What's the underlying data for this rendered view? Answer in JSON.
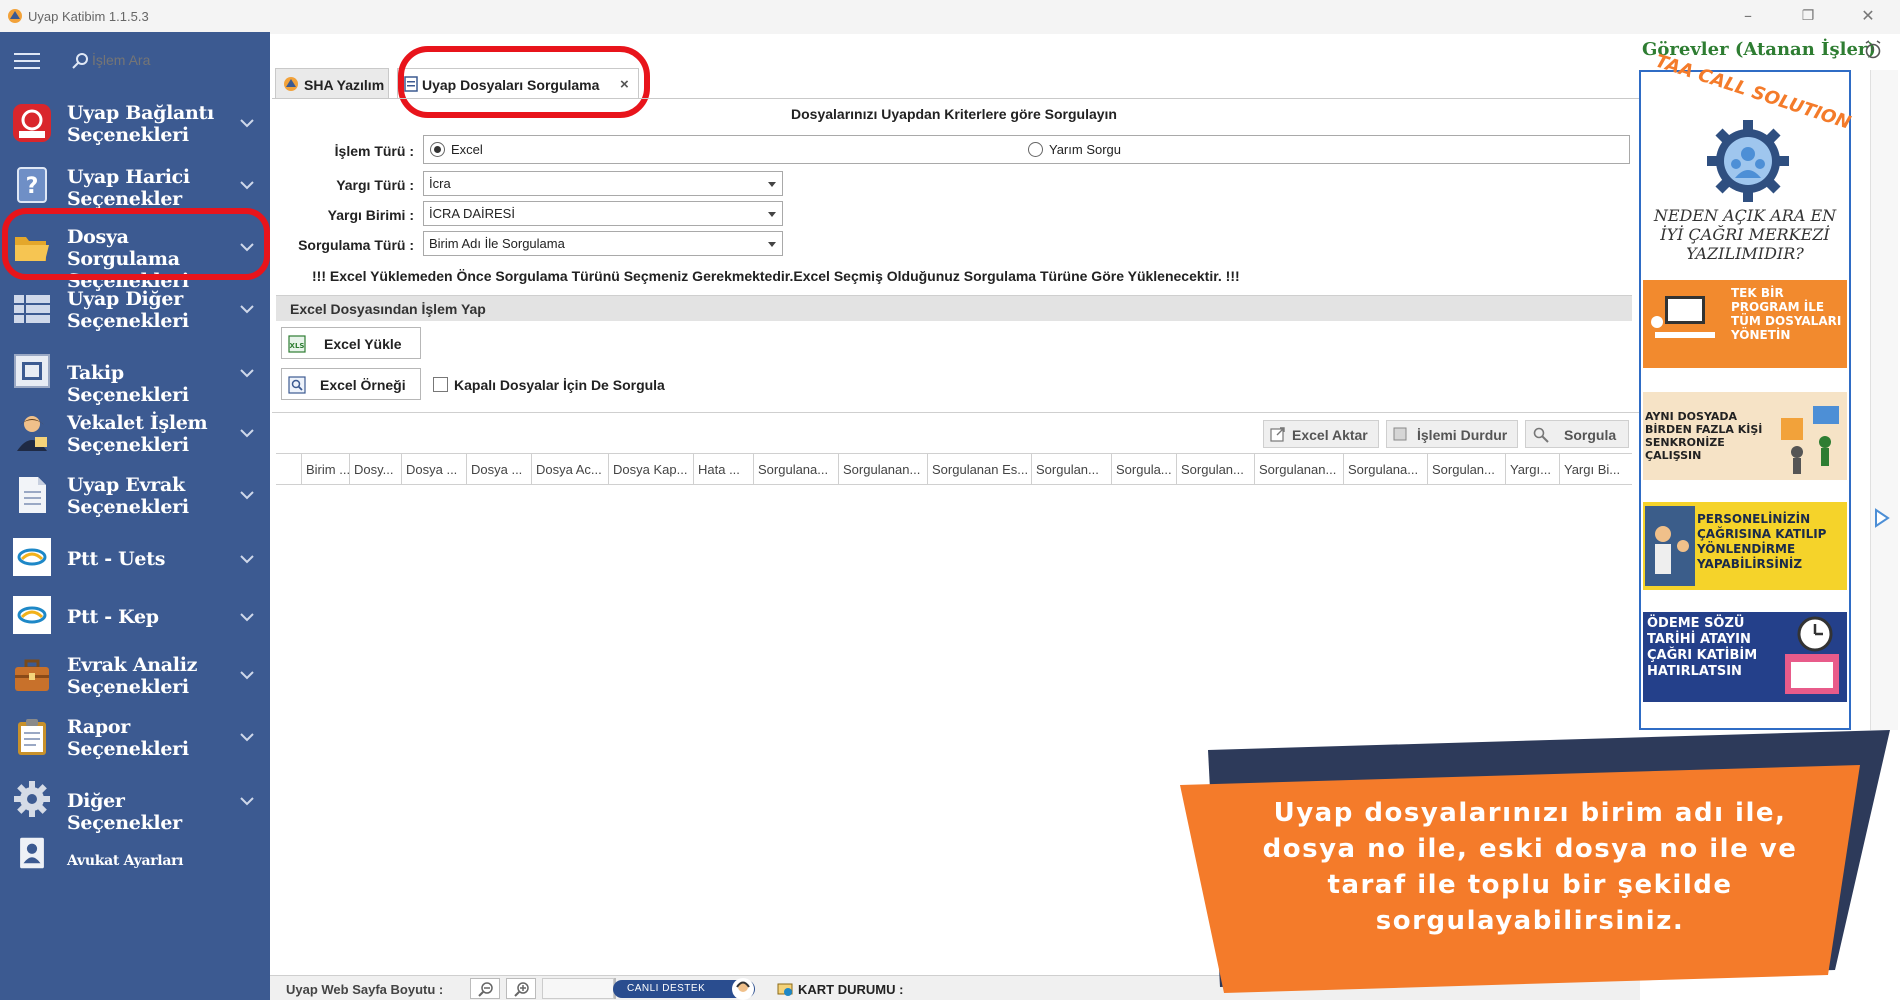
{
  "window": {
    "title": "Uyap Katibim 1.1.5.3",
    "minimize": "–",
    "restore": "❐",
    "close": "✕"
  },
  "search": {
    "placeholder": "İşlem Ara"
  },
  "sidebar": {
    "items": [
      {
        "label": "Uyap Bağlantı Seçenekleri"
      },
      {
        "label": "Uyap Harici Seçenekler"
      },
      {
        "label": "Dosya Sorgulama Seçenekleri"
      },
      {
        "label": "Uyap Diğer Seçenekleri"
      },
      {
        "label": "Takip Seçenekleri"
      },
      {
        "label": "Vekalet İşlem Seçenekleri"
      },
      {
        "label": "Uyap Evrak Seçenekleri"
      },
      {
        "label": "Ptt - Uets"
      },
      {
        "label": "Ptt - Kep"
      },
      {
        "label": "Evrak Analiz Seçenekleri"
      },
      {
        "label": "Rapor Seçenekleri"
      },
      {
        "label": "Diğer Seçenekler"
      },
      {
        "label": "Avukat Ayarları"
      }
    ]
  },
  "tabs": [
    {
      "label": "SHA Yazılım"
    },
    {
      "label": "Uyap Dosyaları Sorgulama",
      "close": "×"
    }
  ],
  "form": {
    "title": "Dosyalarınızı Uyapdan Kriterlere göre Sorgulayın",
    "islem_turu_label": "İşlem Türü :",
    "islem_turu_options": [
      "Excel",
      "Yarım Sorgu"
    ],
    "yargi_turu_label": "Yargı Türü :",
    "yargi_turu_value": "İcra",
    "yargi_birimi_label": "Yargı Birimi :",
    "yargi_birimi_value": "İCRA DAİRESİ",
    "sorgulama_turu_label": "Sorgulama Türü :",
    "sorgulama_turu_value": "Birim Adı İle Sorgulama",
    "warning": "!!!   Excel Yüklemeden Önce Sorgulama Türünü Seçmeniz Gerekmektedir.Excel Seçmiş Olduğunuz Sorgulama Türüne Göre Yüklenecektir.   !!!",
    "excel_section_title": "Excel Dosyasından İşlem Yap",
    "excel_upload": "Excel Yükle",
    "excel_sample": "Excel Örneği",
    "closed_files_checkbox": "Kapalı Dosyalar İçin De Sorgula"
  },
  "toolbar": {
    "export": "Excel Aktar",
    "stop": "İşlemi Durdur",
    "query": "Sorgula"
  },
  "grid": {
    "columns": [
      "Birim ...",
      "Dosy...",
      "Dosya ...",
      "Dosya ...",
      "Dosya Ac...",
      "Dosya Kap...",
      "Hata ...",
      "Sorgulana...",
      "Sorgulanan...",
      "Sorgulanan Es...",
      "Sorgulan...",
      "Sorgula...",
      "Sorgulan...",
      "Sorgulanan...",
      "Sorgulana...",
      "Sorgulan...",
      "Yargı...",
      "Yargı Bi..."
    ]
  },
  "status": {
    "page_size_label": "Uyap Web Sayfa Boyutu :",
    "live_support": "CANLI DESTEK",
    "card_status": "KART DURUMU :"
  },
  "tasks": {
    "title": "Görevler (Atanan İşler)"
  },
  "ad": {
    "brand": "TAA CALL SOLUTION",
    "headline": "NEDEN AÇIK ARA EN İYİ ÇAĞRI MERKEZİ YAZILIMIDIR?",
    "panels": [
      "TEK BİR PROGRAM İLE TÜM DOSYALARI YÖNETİN",
      "AYNI DOSYADA BİRDEN FAZLA KİŞİ SENKRONİZE ÇALIŞSIN",
      "PERSONELİNİZİN ÇAĞRISINA KATILIP YÖNLENDİRME YAPABİLİRSİNİZ",
      "ÖDEME SÖZÜ TARİHİ ATAYIN ÇAĞRI KATİBİM HATIRLATSIN"
    ]
  },
  "callout": {
    "text": "Uyap dosyalarınızı birim adı ile, dosya no ile, eski dosya no ile ve taraf ile toplu bir şekilde sorgulayabilirsiniz."
  },
  "colors": {
    "sidebar": "#3c5a91",
    "highlight_ring": "#e8141b",
    "callout_orange": "#f47b2a",
    "callout_navy": "#2d3a5a",
    "tasks_green": "#2e7d32"
  }
}
